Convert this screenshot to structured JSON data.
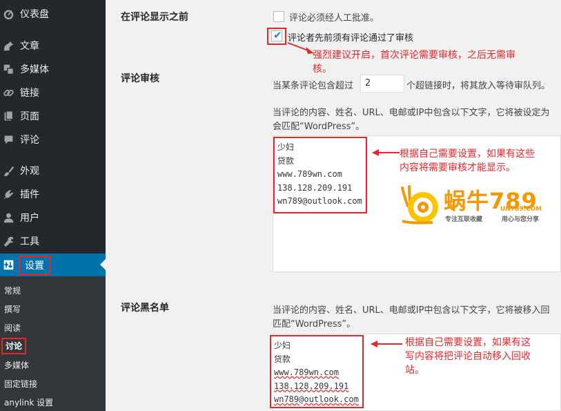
{
  "sidebar": {
    "items": [
      {
        "label": "仪表盘",
        "icon": "dashboard-icon"
      },
      {
        "label": "文章",
        "icon": "pin-icon"
      },
      {
        "label": "多媒体",
        "icon": "media-icon"
      },
      {
        "label": "链接",
        "icon": "link-icon"
      },
      {
        "label": "页面",
        "icon": "page-icon"
      },
      {
        "label": "评论",
        "icon": "comment-icon"
      },
      {
        "label": "外观",
        "icon": "brush-icon"
      },
      {
        "label": "插件",
        "icon": "plugin-icon"
      },
      {
        "label": "用户",
        "icon": "user-icon"
      },
      {
        "label": "工具",
        "icon": "wrench-icon"
      },
      {
        "label": "设置",
        "icon": "settings-icon"
      }
    ],
    "submenu": [
      "常规",
      "撰写",
      "阅读",
      "讨论",
      "多媒体",
      "固定链接",
      "anylink 设置"
    ],
    "current_submenu": "讨论"
  },
  "settings": {
    "before_comment": {
      "label": "在评论显示之前",
      "opt1": "评论必须经人工批准。",
      "opt2": "评论者先前须有评论通过了审核",
      "opt1_checked": false,
      "opt2_checked": true
    },
    "moderation": {
      "label": "评论审核",
      "links_before": "当某条评论包含超过",
      "links_value": "2",
      "links_after": "个超链接时，将其放入等待审队列。",
      "desc_line1": "当评论的内容、姓名、URL、电邮或IP中包含以下文字，它将被设定为",
      "desc_line2": "会匹配“WordPress”。",
      "words": [
        "少妇",
        "贷款",
        "www.789wn.com",
        "138.128.209.191",
        "wn789@outlook.com"
      ]
    },
    "blacklist": {
      "label": "评论黑名单",
      "desc_line1": "当评论的内容、姓名、URL、电邮或IP中包含以下文字，它将被移入回",
      "desc_line2": "匹配“WordPress”。",
      "words": [
        "少妇",
        "贷款",
        "www.789wn.com",
        "138.128.209.191",
        "wn789@outlook.com"
      ]
    }
  },
  "annotations": {
    "a1_line1": "强烈建议开启，首次评论需要审核，之后无需审",
    "a1_line2": "核。",
    "a2_line1": "根据自己需要设置，如果有这些",
    "a2_line2": "内容将需要审核才能显示。",
    "a3_line1": "根据自己需要设置，如果有这",
    "a3_line2": "写内容将把评论自动移入回收",
    "a3_line3": "站。"
  },
  "logo": {
    "brand": "蜗牛789",
    "domain": "UN789.COM",
    "slogan1": "专注互联收藏",
    "slogan2": "用心与您分享"
  },
  "colors": {
    "sidebar_bg": "#23282d",
    "active_bg": "#0073aa",
    "annotation_red": "#e8262a",
    "logo_orange": "#f39800"
  }
}
